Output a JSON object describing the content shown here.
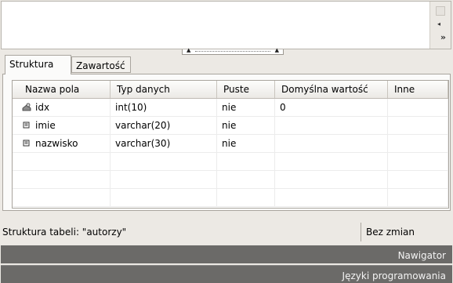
{
  "tabs": [
    {
      "label": "Struktura",
      "active": true
    },
    {
      "label": "Zawartość",
      "active": false
    }
  ],
  "table": {
    "columns": [
      "Nazwa pola",
      "Typ danych",
      "Puste",
      "Domyślna wartość",
      "Inne"
    ],
    "rows": [
      {
        "icon": "primary-key-icon",
        "name": "idx",
        "type": "int(10)",
        "null": "nie",
        "default": "0",
        "other": ""
      },
      {
        "icon": "field-icon",
        "name": "imie",
        "type": "varchar(20)",
        "null": "nie",
        "default": "",
        "other": ""
      },
      {
        "icon": "field-icon",
        "name": "nazwisko",
        "type": "varchar(30)",
        "null": "nie",
        "default": "",
        "other": ""
      }
    ]
  },
  "status": {
    "left": "Struktura tabeli: \"autorzy\"",
    "right": "Bez zmian"
  },
  "bottom_bars": [
    "Nawigator",
    "Języki programowania"
  ]
}
